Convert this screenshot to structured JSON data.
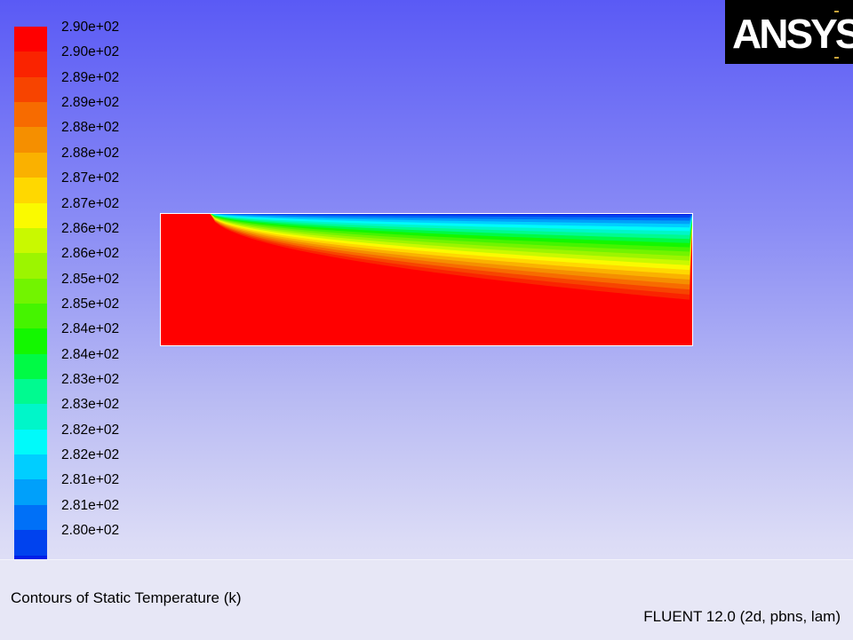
{
  "legend": {
    "labels": [
      "2.90e+02",
      "2.90e+02",
      "2.89e+02",
      "2.89e+02",
      "2.88e+02",
      "2.88e+02",
      "2.87e+02",
      "2.87e+02",
      "2.86e+02",
      "2.86e+02",
      "2.85e+02",
      "2.85e+02",
      "2.84e+02",
      "2.84e+02",
      "2.83e+02",
      "2.83e+02",
      "2.82e+02",
      "2.82e+02",
      "2.81e+02",
      "2.81e+02",
      "2.80e+02"
    ],
    "colors": [
      "#ff0000",
      "#fa2300",
      "#f74400",
      "#f76b00",
      "#f58f00",
      "#fab100",
      "#ffd800",
      "#fafa00",
      "#c9f900",
      "#9cf500",
      "#72f400",
      "#45f400",
      "#13f700",
      "#00fa45",
      "#00fa90",
      "#00f6c9",
      "#00fafa",
      "#00ceff",
      "#00a0fa",
      "#0070f7",
      "#0042ee",
      "#001ee8"
    ]
  },
  "logo": {
    "text": "ANSYS"
  },
  "plot": {
    "field": "Static Temperature",
    "bands": [
      "#001ee8",
      "#0042ee",
      "#0070f7",
      "#00a0fa",
      "#00ceff",
      "#00fafa",
      "#00f6c9",
      "#00fa90",
      "#00fa45",
      "#13f700",
      "#45f400",
      "#72f400",
      "#9cf500",
      "#c9f900",
      "#fafa00",
      "#ffd800",
      "#fab100",
      "#f58f00",
      "#f76b00",
      "#f74400",
      "#fa2300"
    ],
    "background": "#ff0000"
  },
  "footer": {
    "title": "Contours of Static Temperature (k)",
    "version": "FLUENT 12.0 (2d, pbns, lam)"
  }
}
